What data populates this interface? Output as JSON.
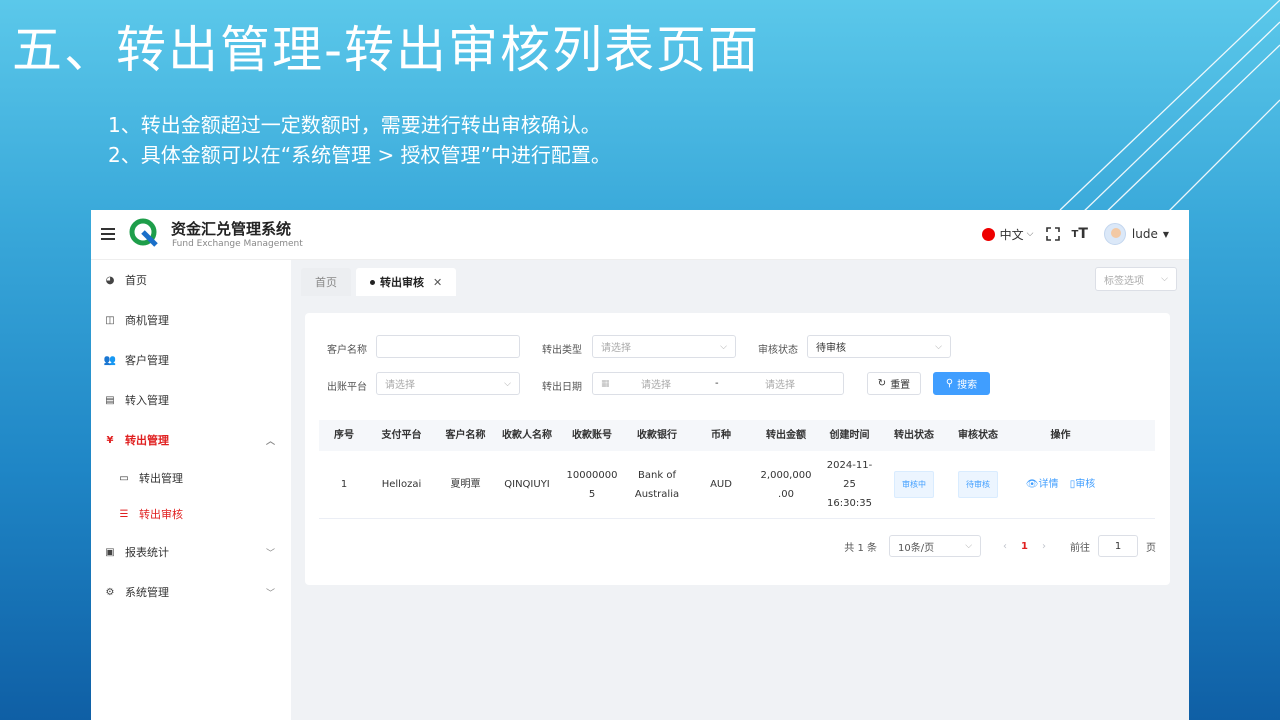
{
  "slide": {
    "title": "五、转出管理-转出审核列表页面",
    "notes": [
      "1、转出金额超过一定数额时，需要进行转出审核确认。",
      "2、具体金额可以在“系统管理 > 授权管理”中进行配置。"
    ]
  },
  "header": {
    "brand_title": "资金汇兑管理系统",
    "brand_subtitle": "Fund Exchange Management",
    "language": "中文",
    "username": "lude",
    "icons": [
      "menu-fold-icon",
      "logo-icon",
      "china-flag-icon",
      "fullscreen-icon",
      "font-size-icon",
      "avatar"
    ]
  },
  "sidebar": {
    "items": [
      {
        "label": "首页",
        "icon": "dashboard-icon"
      },
      {
        "label": "商机管理",
        "icon": "book-icon"
      },
      {
        "label": "客户管理",
        "icon": "users-icon"
      },
      {
        "label": "转入管理",
        "icon": "transfer-in-icon"
      },
      {
        "label": "转出管理",
        "icon": "yen-icon",
        "active": true,
        "expanded": true,
        "children": [
          {
            "label": "转出管理",
            "icon": "card-icon"
          },
          {
            "label": "转出审核",
            "icon": "list-icon",
            "active": true
          }
        ]
      },
      {
        "label": "报表统计",
        "icon": "monitor-icon"
      },
      {
        "label": "系统管理",
        "icon": "gear-icon"
      }
    ]
  },
  "tabs": {
    "items": [
      {
        "label": "首页"
      },
      {
        "label": "转出审核",
        "active": true
      }
    ],
    "options_label": "标签选项"
  },
  "filters": {
    "customer_name_label": "客户名称",
    "customer_name_value": "",
    "transfer_type_label": "转出类型",
    "transfer_type_placeholder": "请选择",
    "audit_status_label": "审核状态",
    "audit_status_value": "待审核",
    "platform_label": "出账平台",
    "platform_placeholder": "请选择",
    "date_label": "转出日期",
    "date_start_placeholder": "请选择",
    "date_separator": "-",
    "date_end_placeholder": "请选择",
    "reset_label": "重置",
    "search_label": "搜索"
  },
  "table": {
    "columns": [
      "序号",
      "支付平台",
      "客户名称",
      "收款人名称",
      "收款账号",
      "收款银行",
      "币种",
      "转出金额",
      "创建时间",
      "转出状态",
      "审核状态",
      "操作"
    ],
    "rows": [
      {
        "index": "1",
        "platform": "Hellozai",
        "customer": "夏明覃",
        "payee": "QINQIUYI",
        "account_line1": "10000000",
        "account_line2": "5",
        "bank_line1": "Bank of",
        "bank_line2": "Australia",
        "currency": "AUD",
        "amount_line1": "2,000,000",
        "amount_line2": ".00",
        "created_line1": "2024-11-",
        "created_line2": "25",
        "created_line3": "16:30:35",
        "transfer_status": "审核中",
        "audit_status": "待审核",
        "action_detail": "详情",
        "action_audit": "审核"
      }
    ]
  },
  "pagination": {
    "total": "共 1 条",
    "page_size": "10条/页",
    "current_page": "1",
    "goto_label": "前往",
    "goto_value": "1",
    "page_suffix": "页"
  }
}
